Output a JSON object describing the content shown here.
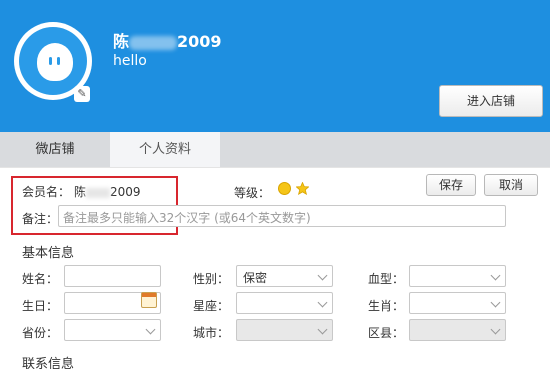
{
  "header": {
    "username_prefix": "陈",
    "username_suffix": "2009",
    "signature": "hello",
    "enter_shop_label": "进入店铺"
  },
  "tabs": [
    {
      "label": "微店铺",
      "active": false
    },
    {
      "label": "个人资料",
      "active": true
    }
  ],
  "member": {
    "name_label": "会员名：",
    "name_prefix": "陈",
    "name_suffix": "2009",
    "level_label": "等级：",
    "note_label": "备注：",
    "note_placeholder": "备注最多只能输入32个汉字 (或64个英文数字)"
  },
  "actions": {
    "save_label": "保存",
    "cancel_label": "取消"
  },
  "basic_info": {
    "title": "基本信息",
    "name_label": "姓名：",
    "gender_label": "性别：",
    "gender_value": "保密",
    "blood_label": "血型：",
    "birthday_label": "生日：",
    "zodiac_label": "星座：",
    "chinese_zodiac_label": "生肖：",
    "province_label": "省份：",
    "city_label": "城市：",
    "district_label": "区县："
  },
  "contact_info": {
    "title": "联系信息"
  },
  "colors": {
    "header_bg": "#1e8fe0",
    "highlight_box": "#d8262e"
  }
}
